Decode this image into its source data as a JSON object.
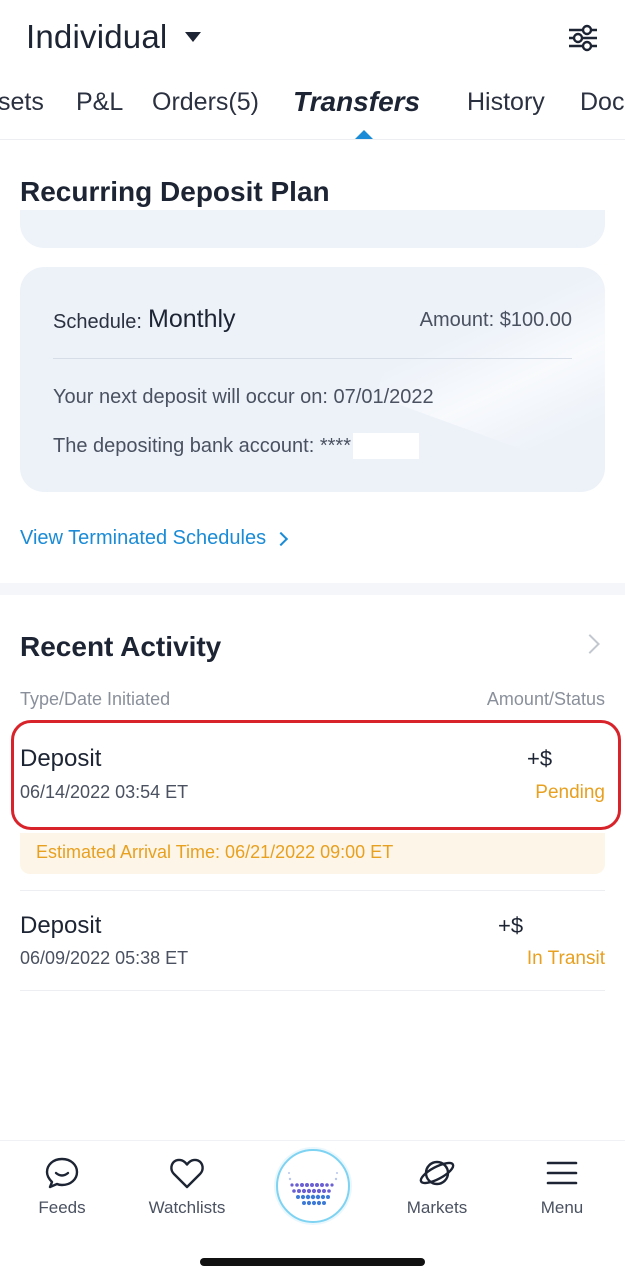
{
  "header": {
    "account_title": "Individual"
  },
  "tabs": [
    {
      "label": "sets"
    },
    {
      "label": "P&L"
    },
    {
      "label": "Orders(5)"
    },
    {
      "label": "Transfers",
      "active": true
    },
    {
      "label": "History"
    },
    {
      "label": "Doc"
    }
  ],
  "recurring": {
    "title": "Recurring Deposit Plan",
    "schedule_label": "Schedule:",
    "schedule_value": "Monthly",
    "amount": "Amount: $100.00",
    "next_deposit": "Your next deposit will occur on: 07/01/2022",
    "bank_account": "The depositing bank account: ****",
    "terminated_link": "View Terminated Schedules"
  },
  "recent_activity": {
    "title": "Recent Activity",
    "col_left": "Type/Date Initiated",
    "col_right": "Amount/Status",
    "items": [
      {
        "type": "Deposit",
        "date": "06/14/2022 03:54 ET",
        "amount": "+$",
        "status": "Pending",
        "eta": "Estimated Arrival Time: 06/21/2022 09:00 ET"
      },
      {
        "type": "Deposit",
        "date": "06/09/2022 05:38 ET",
        "amount": "+$",
        "status": "In Transit"
      }
    ]
  },
  "bottom_nav": [
    {
      "label": "Feeds",
      "icon": "feeds-icon"
    },
    {
      "label": "Watchlists",
      "icon": "heart-icon"
    },
    {
      "label": "",
      "icon": "home-logo-icon"
    },
    {
      "label": "Markets",
      "icon": "planet-icon"
    },
    {
      "label": "Menu",
      "icon": "hamburger-icon"
    }
  ],
  "colors": {
    "accent": "#1a8bd6",
    "pending": "#e8a020",
    "highlight": "#d8232a",
    "card_bg": "#edf2f9"
  }
}
